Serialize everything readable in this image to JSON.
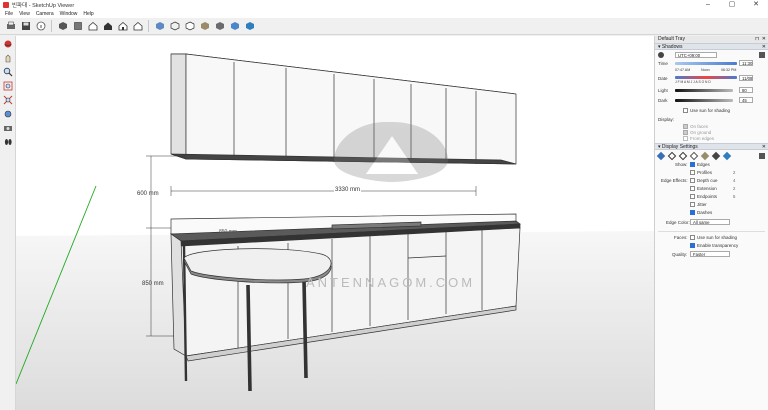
{
  "window": {
    "title": "빈파대 - SketchUp Viewer"
  },
  "menubar": {
    "items": [
      "File",
      "View",
      "Camera",
      "Window",
      "Help"
    ]
  },
  "toolbar": {
    "icons": [
      "print-icon",
      "save-icon",
      "info-icon",
      "iso-view-icon",
      "top-view-icon",
      "front-view-icon",
      "right-view-icon",
      "back-view-icon",
      "left-view-icon",
      "xray-icon",
      "wireframe-icon",
      "hidden-line-icon",
      "shaded-icon",
      "shaded-texture-icon",
      "monochrome-icon"
    ]
  },
  "lefttools": {
    "icons": [
      "orbit-icon",
      "pan-icon",
      "zoom-icon",
      "zoom-window-icon",
      "zoom-extents-icon",
      "look-around-icon",
      "walk-icon",
      "position-camera-icon"
    ]
  },
  "viewport": {
    "dim_width": "3330 mm",
    "dim_upper_height": "600 mm",
    "dim_counter_height": "850 mm",
    "dim_counter_depth": "850 mm",
    "watermark_text": "ANTENNAGOM.COM"
  },
  "tray": {
    "title": "Default Tray",
    "shadows": {
      "header": "Shadows",
      "tz_select": "UTC+09:00",
      "time_label": "Time",
      "time_value": "11:30",
      "time_start": "07:47 AM",
      "time_noon": "Noon",
      "time_end": "06:32 PM",
      "date_label": "Date",
      "date_months": "J F M A M J J A S O N D",
      "date_value": "11/08",
      "light_label": "Light",
      "light_value": "80",
      "dark_label": "Dark",
      "dark_value": "45",
      "use_sun_label": "Use sun for shading",
      "display_label": "Display:",
      "on_faces": "On faces",
      "on_ground": "On ground",
      "from_edges": "From edges"
    },
    "display_settings": {
      "header": "Display Settings",
      "show_label": "Show:",
      "edges": "Edges",
      "profiles": "Profiles",
      "profiles_val": "2",
      "edge_effects_label": "Edge Effects:",
      "depth_cue": "Depth cue",
      "depth_cue_val": "4",
      "extension": "Extension",
      "extension_val": "2",
      "endpoints": "Endpoints",
      "endpoints_val": "5",
      "jitter": "Jitter",
      "dashes": "Dashes",
      "edge_color_label": "Edge Color:",
      "edge_color_value": "All same",
      "faces_label": "Faces:",
      "use_sun": "Use sun for shading",
      "enable_transparency": "Enable transparency",
      "quality_label": "Quality:",
      "quality_value": "Faster"
    }
  },
  "colors": {
    "accent": "#2a6fd6",
    "axis_green": "#22aa22"
  }
}
